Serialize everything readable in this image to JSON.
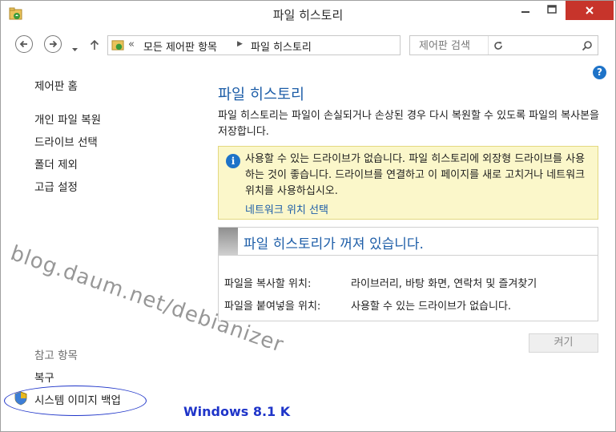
{
  "window": {
    "title": "파일 히스토리"
  },
  "address_bar": {
    "overflow": "«",
    "crumbs": [
      "모든 제어판 항목",
      "파일 히스토리"
    ],
    "separator": "▶"
  },
  "search": {
    "placeholder": "제어판 검색"
  },
  "sidebar": {
    "home": "제어판 홈",
    "items": [
      "개인 파일 복원",
      "드라이브 선택",
      "폴더 제외",
      "고급 설정"
    ],
    "see_also_header": "참고 항목",
    "see_also": [
      "복구",
      "시스템 이미지 백업"
    ]
  },
  "main": {
    "title": "파일 히스토리",
    "description": "파일 히스토리는 파일이 손실되거나 손상된 경우 다시 복원할 수 있도록 파일의 복사본을 저장합니다.",
    "info": {
      "message": "사용할 수 있는 드라이브가 없습니다. 파일 히스토리에 외장형 드라이브를 사용하는 것이 좋습니다. 드라이브를 연결하고 이 페이지를 새로 고치거나 네트워크 위치를 사용하십시오.",
      "link": "네트워크 위치 선택"
    },
    "status": {
      "title": "파일 히스토리가 꺼져 있습니다.",
      "rows": [
        {
          "label": "파일을 복사할 위치:",
          "value": "라이브러리, 바탕 화면, 연락처 및 즐겨찾기"
        },
        {
          "label": "파일을 붙여넣을 위치:",
          "value": "사용할 수 있는 드라이브가 없습니다."
        }
      ]
    },
    "turn_on_button": "켜기"
  },
  "annotations": {
    "watermark": "blog.daum.net/debianizer",
    "caption": "Windows 8.1 K"
  },
  "colors": {
    "accent": "#1e5ea8",
    "close_button": "#c7342b",
    "info_background": "#fbf7ca",
    "annotation": "#1f35c9"
  }
}
